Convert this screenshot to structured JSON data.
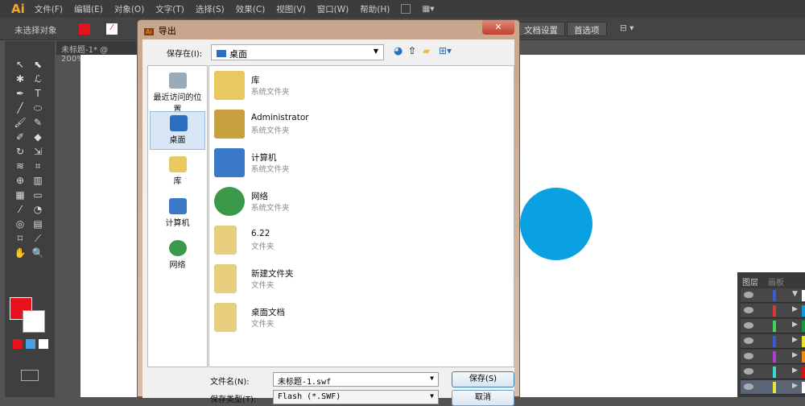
{
  "menubar": {
    "logo": "Ai",
    "items": [
      "文件(F)",
      "编辑(E)",
      "对象(O)",
      "文字(T)",
      "选择(S)",
      "效果(C)",
      "视图(V)",
      "窗口(W)",
      "帮助(H)"
    ]
  },
  "control": {
    "selection": "未选择对象",
    "doc_setup": "文档设置",
    "preferences": "首选项",
    "fill_color": "#e8101a"
  },
  "doc_tab": "未标题-1* @ 200%",
  "canvas": {
    "circle_color": "#0aa1e3"
  },
  "dialog": {
    "title": "导出",
    "close": "✕",
    "save_in_label": "保存在(I):",
    "save_in_value": "桌面",
    "places": [
      {
        "label": "最近访问的位置",
        "color": "#9ab"
      },
      {
        "label": "桌面",
        "color": "#2a6fc0"
      },
      {
        "label": "库",
        "color": "#e8c860"
      },
      {
        "label": "计算机",
        "color": "#3a78c8"
      },
      {
        "label": "网络",
        "color": "#3a9a4a"
      }
    ],
    "files": [
      {
        "name": "库",
        "type": "系统文件夹",
        "color": "#e8c860"
      },
      {
        "name": "Administrator",
        "type": "系统文件夹",
        "color": "#c8a040"
      },
      {
        "name": "计算机",
        "type": "系统文件夹",
        "color": "#3a78c8"
      },
      {
        "name": "网络",
        "type": "系统文件夹",
        "color": "#3a9a4a"
      },
      {
        "name": "6.22",
        "type": "文件夹",
        "color": "#e8cf80"
      },
      {
        "name": "新建文件夹",
        "type": "文件夹",
        "color": "#e8cf80"
      },
      {
        "name": "桌面文档",
        "type": "文件夹",
        "color": "#e8cf80"
      }
    ],
    "filename_label": "文件名(N):",
    "filename_value": "未标题-1.swf",
    "filetype_label": "保存类型(T):",
    "filetype_value": "Flash (*.SWF)",
    "save_button": "保存(S)",
    "cancel_button": "取消"
  },
  "layers": {
    "tabs": [
      "图层",
      "画板"
    ],
    "rows": [
      {
        "color": "#3b5bd6",
        "sw": "#fff"
      },
      {
        "color": "#d63b3b",
        "sw": "#0a9ee0"
      },
      {
        "color": "#3bd65b",
        "sw": "#1a9a3a"
      },
      {
        "color": "#3b5bd6",
        "sw": "#f0e020"
      },
      {
        "color": "#b03bd6",
        "sw": "#f08a10"
      },
      {
        "color": "#3bd6d6",
        "sw": "#e01010"
      },
      {
        "color": "#e6e63b",
        "sw": "#fff"
      }
    ]
  }
}
